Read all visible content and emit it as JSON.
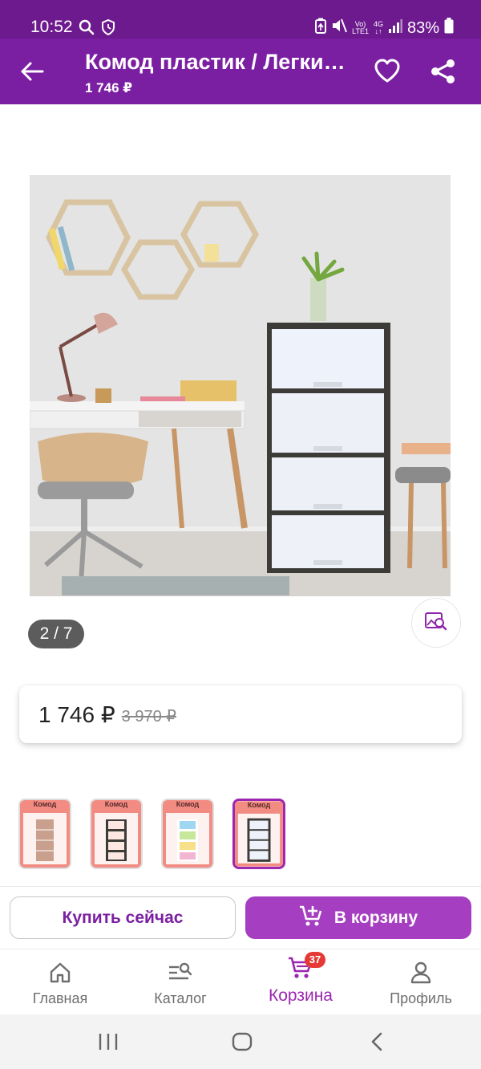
{
  "status_bar": {
    "time": "10:52",
    "network": {
      "line1": "Vo)",
      "line2": "LTE1"
    },
    "network_type": "4G",
    "battery": "83%",
    "icons": [
      "search-icon",
      "shield-icon",
      "battery-saver-icon",
      "mute-icon",
      "signal-icon",
      "battery-icon"
    ]
  },
  "app_bar": {
    "title": "Комод пластик / Легкий пластиковый комод",
    "subtitle": "1 746 ₽",
    "icons": [
      "back-arrow-icon",
      "heart-icon",
      "share-icon"
    ]
  },
  "gallery": {
    "counter": "2 / 7",
    "zoom_icon": "image-search-icon"
  },
  "price": {
    "current": "1 746 ₽",
    "old": "3 970 ₽"
  },
  "thumbnails": [
    {
      "label": "Комод",
      "color": "brown"
    },
    {
      "label": "Комод",
      "color": "white"
    },
    {
      "label": "Комод",
      "color": "multicolor"
    },
    {
      "label": "Комод",
      "color": "graphite"
    }
  ],
  "actions": {
    "buy_now": "Купить сейчас",
    "add_to_cart": "В корзину"
  },
  "bottom_nav": {
    "items": [
      {
        "label": "Главная",
        "icon": "home-icon"
      },
      {
        "label": "Каталог",
        "icon": "catalog-search-icon"
      },
      {
        "label": "Корзина",
        "icon": "cart-icon",
        "active": true
      },
      {
        "label": "Профиль",
        "icon": "profile-icon"
      }
    ],
    "cart_badge": "37"
  },
  "colors": {
    "status_bar": "#6d1a8e",
    "app_bar": "#7b1fa2",
    "accent": "#9c27b0",
    "cart_button": "#a63ec2",
    "badge": "#e53935"
  }
}
